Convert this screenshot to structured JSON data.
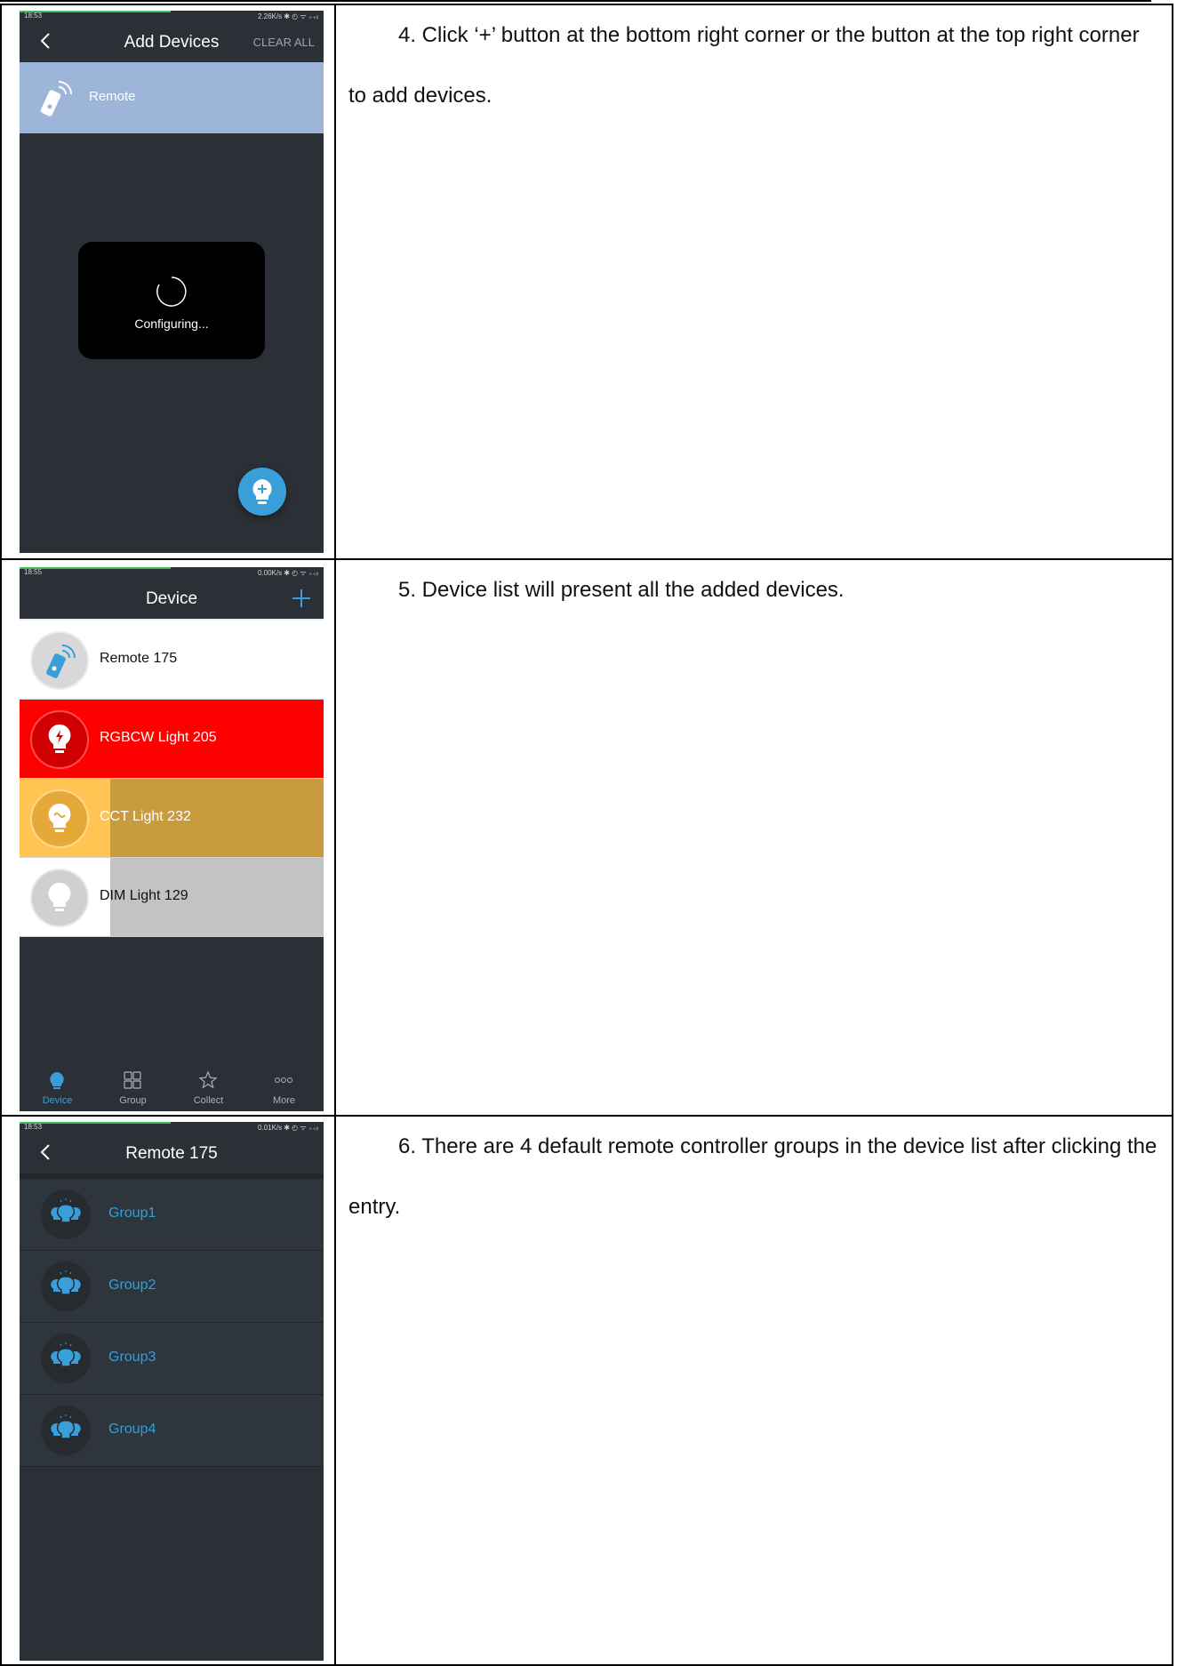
{
  "rows": [
    {
      "step_text": "4. Click ‘+’ button at the bottom right corner or the button at the top right corner to add devices.",
      "phone": {
        "status_time": "18:53",
        "status_right": "2.26K/s ✱ ◴ ᯤ ₊₊ᵢₗ",
        "title": "Add Devices",
        "action": "CLEAR ALL",
        "item_label": "Remote",
        "dialog_text": "Configuring..."
      }
    },
    {
      "step_text": "5. Device list will present all the added devices.",
      "phone": {
        "status_time": "18:55",
        "status_right": "0.00K/s ✱ ◴ ᯤ ₊₊ᵢₗ",
        "title": "Device",
        "devices": [
          {
            "label": "Remote 175",
            "color": "#ffffff"
          },
          {
            "label": "RGBCW Light 205",
            "color": "#ff0000"
          },
          {
            "label": "CCT Light 232",
            "color": "#c89b3e"
          },
          {
            "label": "DIM Light 129",
            "color": "#c3c3c3"
          }
        ],
        "tabs": [
          "Device",
          "Group",
          "Collect",
          "More"
        ]
      }
    },
    {
      "step_text": "6. There are 4 default remote controller groups in the device list after clicking the entry.",
      "phone": {
        "status_time": "18:53",
        "status_right": "0.01K/s ✱ ◴ ᯤ ₊₊ᵢₗ",
        "title": "Remote 175",
        "groups": [
          "Group1",
          "Group2",
          "Group3",
          "Group4"
        ]
      }
    }
  ],
  "colors": {
    "app_bg": "#2b3036",
    "accent_blue": "#3a9fd8",
    "remote_row": "#9db5d8",
    "group_text": "#2f9fe0"
  }
}
